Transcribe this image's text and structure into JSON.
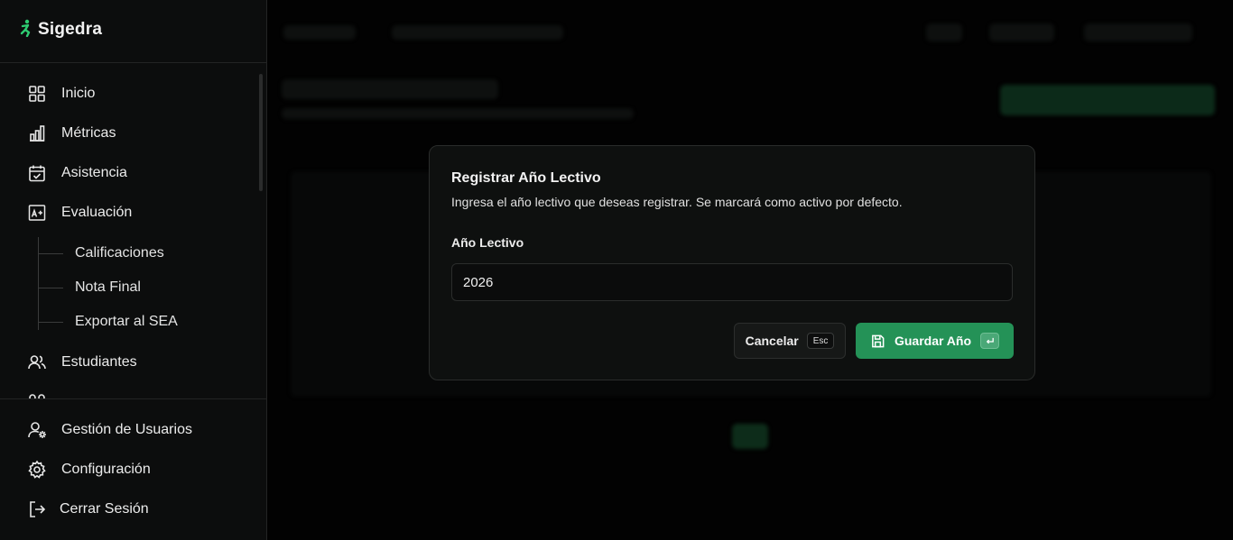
{
  "app": {
    "name": "Sigedra",
    "brand_color": "#2ecc71"
  },
  "sidebar": {
    "items": [
      {
        "label": "Inicio",
        "icon": "grid-icon"
      },
      {
        "label": "Métricas",
        "icon": "bar-chart-icon"
      },
      {
        "label": "Asistencia",
        "icon": "calendar-check-icon"
      },
      {
        "label": "Evaluación",
        "icon": "grade-icon"
      }
    ],
    "sub_items": [
      {
        "label": "Calificaciones"
      },
      {
        "label": "Nota Final"
      },
      {
        "label": "Exportar al SEA"
      }
    ],
    "more_items": [
      {
        "label": "Estudiantes",
        "icon": "users-icon"
      }
    ],
    "bottom_items": [
      {
        "label": "Gestión de Usuarios",
        "icon": "user-gear-icon"
      },
      {
        "label": "Configuración",
        "icon": "gear-icon"
      },
      {
        "label": "Cerrar Sesión",
        "icon": "logout-icon"
      }
    ]
  },
  "modal": {
    "title": "Registrar Año Lectivo",
    "description": "Ingresa el año lectivo que deseas registrar. Se marcará como activo por defecto.",
    "field_label": "Año Lectivo",
    "field_value": "2026",
    "cancel_label": "Cancelar",
    "cancel_shortcut": "Esc",
    "save_label": "Guardar Año",
    "save_color": "#249257"
  }
}
